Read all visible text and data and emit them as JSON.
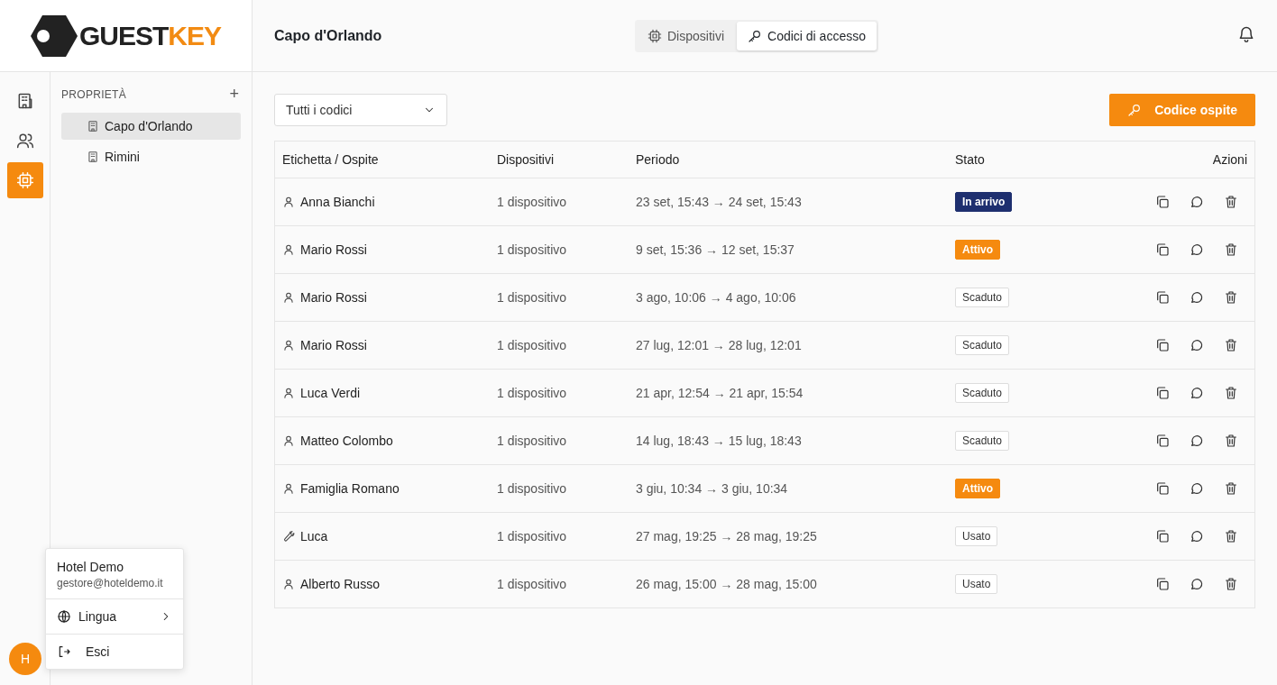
{
  "logo": {
    "part_1": "GUEST",
    "part_2": "KEY"
  },
  "header": {
    "title": "Capo d'Orlando",
    "tabs": [
      {
        "label": "Dispositivi",
        "kind": "devices",
        "selected": false
      },
      {
        "label": "Codici di accesso",
        "kind": "codes",
        "selected": true
      }
    ]
  },
  "rail": [
    {
      "kind": "properties",
      "selected": false
    },
    {
      "kind": "people",
      "selected": false
    },
    {
      "kind": "devices",
      "selected": true
    }
  ],
  "sidebar": {
    "heading": "PROPRIETÀ",
    "add": "+",
    "items": [
      {
        "label": "Capo d'Orlando",
        "selected": true
      },
      {
        "label": "Rimini",
        "selected": false
      }
    ]
  },
  "filter": {
    "value": "Tutti i codici"
  },
  "new_button": "Codice ospite",
  "table": {
    "columns": [
      "Etichetta / Ospite",
      "Dispositivi",
      "Periodo",
      "Stato",
      "Azioni"
    ],
    "rows": [
      {
        "kind": "guest",
        "label": "Anna Bianchi",
        "devices": "1 dispositivo",
        "period": "23 set, 15:43 → 24 set, 15:43",
        "status": {
          "kind": "incoming",
          "label": "In arrivo"
        }
      },
      {
        "kind": "guest",
        "label": "Mario Rossi",
        "devices": "1 dispositivo",
        "period": "9 set, 15:36 → 12 set, 15:37",
        "status": {
          "kind": "active",
          "label": "Attivo"
        }
      },
      {
        "kind": "guest",
        "label": "Mario Rossi",
        "devices": "1 dispositivo",
        "period": "3 ago, 10:06 → 4 ago, 10:06",
        "status": {
          "kind": "plain",
          "label": "Scaduto"
        }
      },
      {
        "kind": "guest",
        "label": "Mario Rossi",
        "devices": "1 dispositivo",
        "period": "27 lug, 12:01 → 28 lug, 12:01",
        "status": {
          "kind": "plain",
          "label": "Scaduto"
        }
      },
      {
        "kind": "guest",
        "label": "Luca Verdi",
        "devices": "1 dispositivo",
        "period": "21 apr, 12:54 → 21 apr, 15:54",
        "status": {
          "kind": "plain",
          "label": "Scaduto"
        }
      },
      {
        "kind": "guest",
        "label": "Matteo Colombo",
        "devices": "1 dispositivo",
        "period": "14 lug, 18:43 → 15 lug, 18:43",
        "status": {
          "kind": "plain",
          "label": "Scaduto"
        }
      },
      {
        "kind": "guest",
        "label": "Famiglia Romano",
        "devices": "1 dispositivo",
        "period": "3 giu, 10:34 → 3 giu, 10:34",
        "status": {
          "kind": "active",
          "label": "Attivo"
        }
      },
      {
        "kind": "service",
        "label": "Luca",
        "devices": "1 dispositivo",
        "period": "27 mag, 19:25 → 28 mag, 19:25",
        "status": {
          "kind": "plain",
          "label": "Usato"
        }
      },
      {
        "kind": "guest",
        "label": "Alberto Russo",
        "devices": "1 dispositivo",
        "period": "26 mag, 15:00 → 28 mag, 15:00",
        "status": {
          "kind": "plain",
          "label": "Usato"
        }
      }
    ]
  },
  "user_menu": {
    "name": "Hotel Demo",
    "email": "gestore@hoteldemo.it",
    "items": [
      {
        "kind": "language",
        "label": "Lingua"
      },
      {
        "kind": "logout",
        "label": "Esci"
      }
    ]
  },
  "avatar": "H"
}
